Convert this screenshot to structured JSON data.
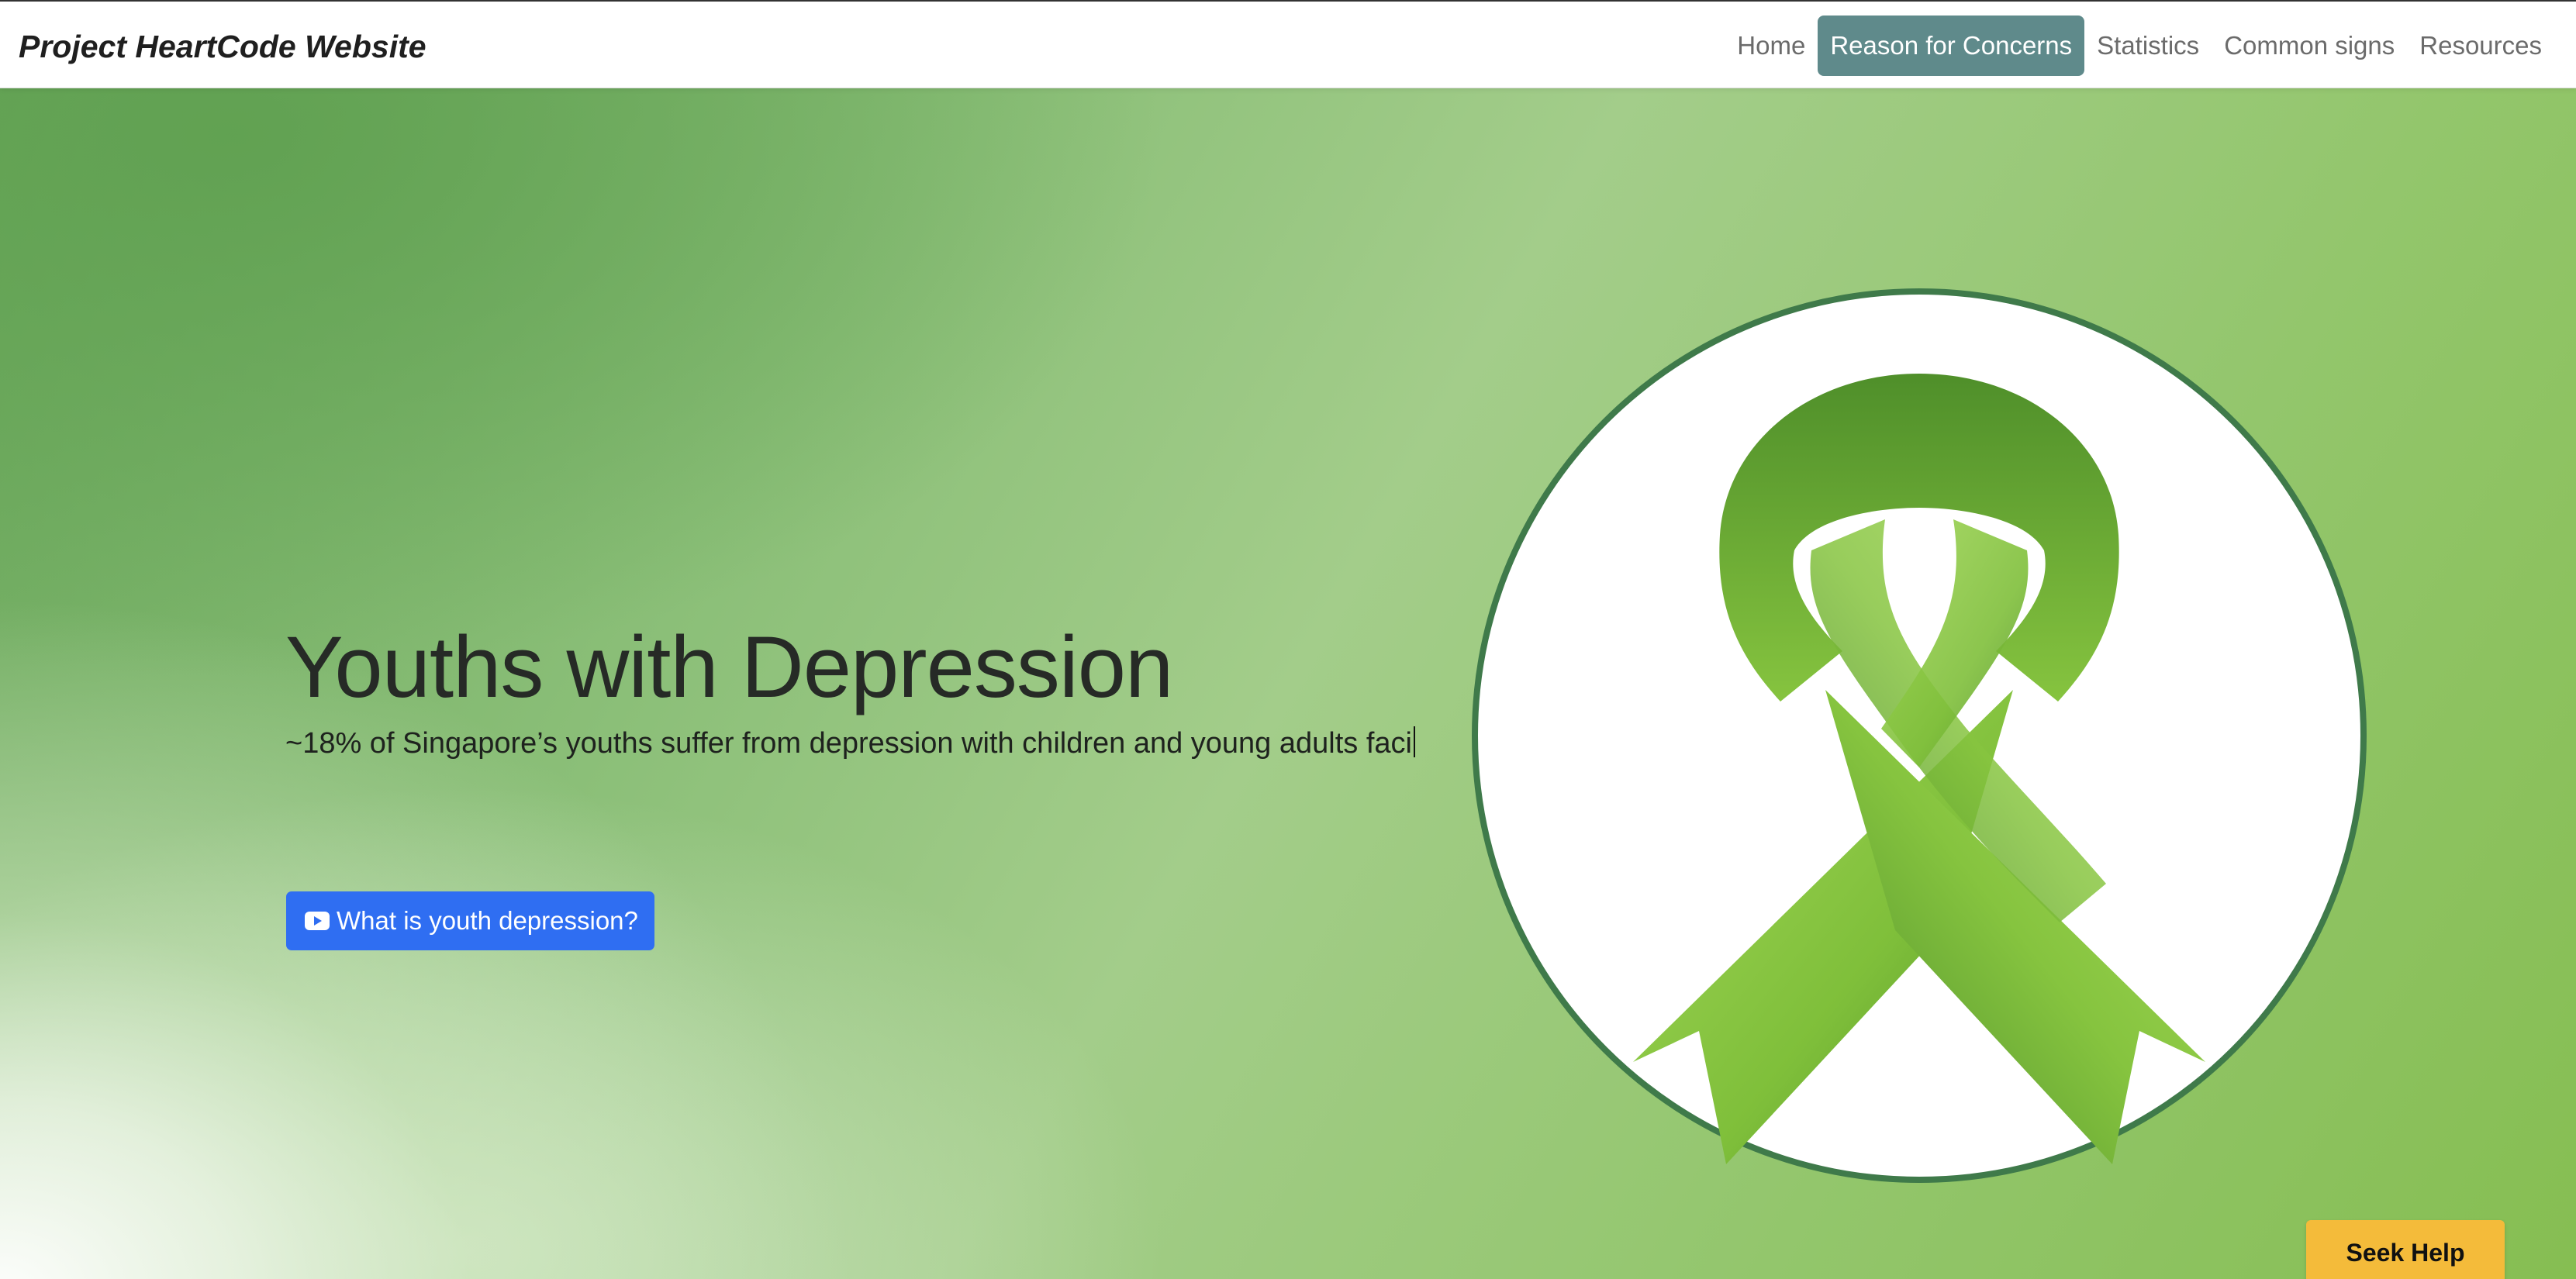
{
  "navbar": {
    "brand": "Project HeartCode Website",
    "links": [
      {
        "label": "Home",
        "active": false
      },
      {
        "label": "Reason for Concerns",
        "active": true
      },
      {
        "label": "Statistics",
        "active": false
      },
      {
        "label": "Common signs",
        "active": false
      },
      {
        "label": "Resources",
        "active": false
      }
    ]
  },
  "hero": {
    "title": "Youths with Depression",
    "subtitle": "~18% of Singapore’s youths suffer from depression with children and young adults faci",
    "cta_label": "What is youth depression?",
    "cta_icon": "youtube-icon",
    "image_icon": "green-ribbon-icon"
  },
  "seek_help": {
    "label": "Seek Help"
  },
  "colors": {
    "active_nav": "#5f8a8b",
    "cta": "#2f6ef2",
    "seek_help": "#f4bb3a",
    "ribbon": "#7fbf3a"
  }
}
